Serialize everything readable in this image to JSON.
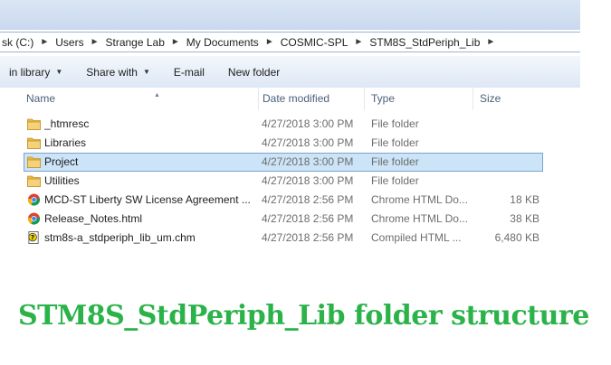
{
  "address_bar": {
    "crumbs": [
      "sk (C:)",
      "Users",
      "Strange Lab",
      "My Documents",
      "COSMIC-SPL",
      "STM8S_StdPeriph_Lib"
    ]
  },
  "toolbar": {
    "include_in_library": "in library",
    "share_with": "Share with",
    "email": "E-mail",
    "new_folder": "New folder"
  },
  "columns": {
    "name": "Name",
    "date": "Date modified",
    "type": "Type",
    "size": "Size"
  },
  "files": [
    {
      "name": "_htmresc",
      "date": "4/27/2018 3:00 PM",
      "type": "File folder",
      "size": "",
      "icon": "folder-icon"
    },
    {
      "name": "Libraries",
      "date": "4/27/2018 3:00 PM",
      "type": "File folder",
      "size": "",
      "icon": "folder-icon"
    },
    {
      "name": "Project",
      "date": "4/27/2018 3:00 PM",
      "type": "File folder",
      "size": "",
      "icon": "folder-icon",
      "selected": true
    },
    {
      "name": "Utilities",
      "date": "4/27/2018 3:00 PM",
      "type": "File folder",
      "size": "",
      "icon": "folder-icon"
    },
    {
      "name": "MCD-ST Liberty SW License Agreement ...",
      "date": "4/27/2018 2:56 PM",
      "type": "Chrome HTML Do...",
      "size": "18 KB",
      "icon": "chrome-icon"
    },
    {
      "name": "Release_Notes.html",
      "date": "4/27/2018 2:56 PM",
      "type": "Chrome HTML Do...",
      "size": "38 KB",
      "icon": "chrome-icon"
    },
    {
      "name": "stm8s-a_stdperiph_lib_um.chm",
      "date": "4/27/2018 2:56 PM",
      "type": "Compiled HTML ...",
      "size": "6,480 KB",
      "icon": "help-file-icon"
    }
  ],
  "caption": "STM8S_StdPeriph_Lib folder structure",
  "colors": {
    "caption": "#2bb34a",
    "selection": "#cce4f7",
    "selection_border": "#7da2ce",
    "folder": "#e8b941"
  }
}
